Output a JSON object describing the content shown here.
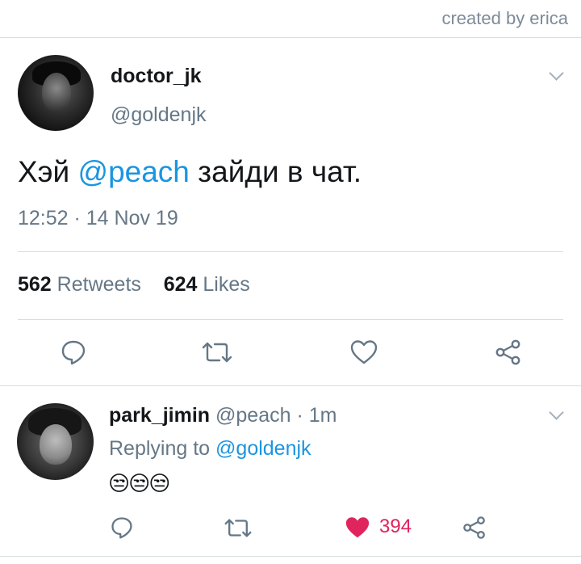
{
  "credit": "created by erica",
  "main_tweet": {
    "display_name": "doctor_jk",
    "handle": "@goldenjk",
    "text_before": "Хэй ",
    "mention": "@peach",
    "text_after": " зайди в чат.",
    "timestamp": "12:52 · 14 Nov 19",
    "retweets_count": "562",
    "retweets_label": "Retweets",
    "likes_count": "624",
    "likes_label": "Likes"
  },
  "reply": {
    "display_name": "park_jimin",
    "handle": "@peach",
    "time": "· 1m",
    "replying_prefix": "Replying to",
    "replying_to": "@goldenjk",
    "emojis": "😒😒😒",
    "like_count": "394"
  },
  "icons": [
    "reply-icon",
    "retweet-icon",
    "like-icon",
    "share-icon",
    "chevron-down-icon",
    "heart-filled-icon"
  ],
  "colors": {
    "accent": "#1b95e0",
    "like": "#e0245e",
    "muted": "#657786"
  }
}
